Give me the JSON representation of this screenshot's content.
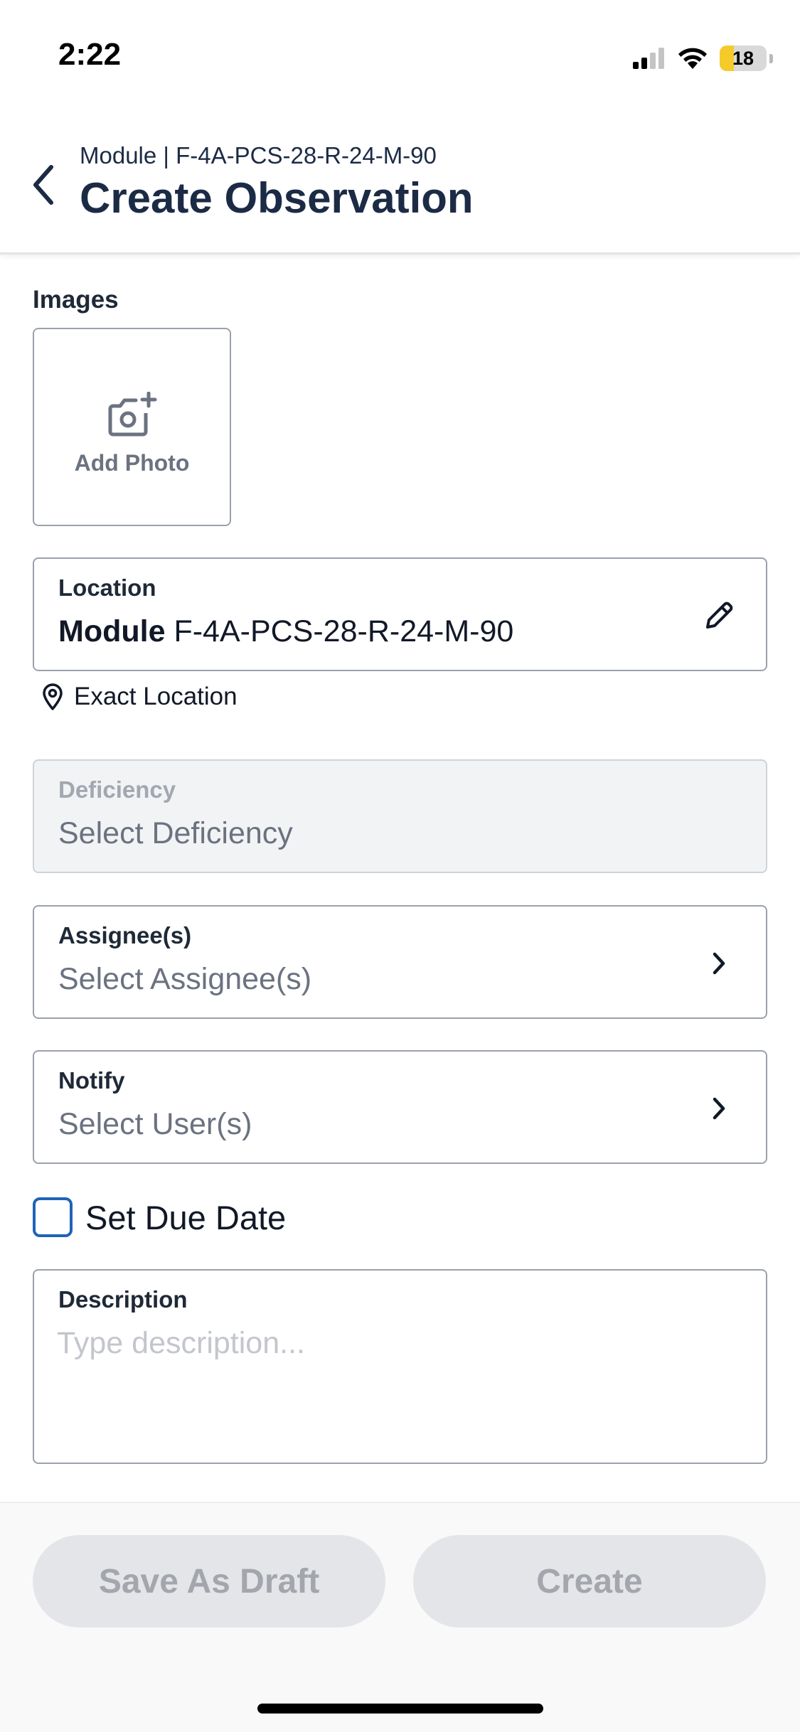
{
  "status_bar": {
    "time": "2:22",
    "battery_level": "18",
    "icons": [
      "cellular-signal-icon",
      "wifi-icon",
      "battery-icon"
    ]
  },
  "header": {
    "subtitle": "Module | F-4A-PCS-28-R-24-M-90",
    "title": "Create Observation",
    "back_icon": "chevron-left-icon"
  },
  "images": {
    "label": "Images",
    "add_photo_label": "Add Photo",
    "add_photo_icon": "camera-plus-icon"
  },
  "location": {
    "label": "Location",
    "type": "Module",
    "id": "F-4A-PCS-28-R-24-M-90",
    "edit_icon": "pencil-icon",
    "exact_location_label": "Exact Location",
    "exact_location_icon": "map-pin-icon"
  },
  "deficiency": {
    "label": "Deficiency",
    "placeholder": "Select Deficiency"
  },
  "assignees": {
    "label": "Assignee(s)",
    "placeholder": "Select Assignee(s)"
  },
  "notify": {
    "label": "Notify",
    "placeholder": "Select User(s)"
  },
  "due_date": {
    "label": "Set Due Date",
    "checked": false
  },
  "description": {
    "label": "Description",
    "placeholder": "Type description..."
  },
  "footer": {
    "save_draft_label": "Save As Draft",
    "create_label": "Create"
  },
  "colors": {
    "primary_text": "#1c2b45",
    "accent": "#1e63b8",
    "disabled_button_bg": "#e4e5e8",
    "disabled_button_text": "#a3a6ac",
    "battery_fill": "#f5cb2b"
  }
}
